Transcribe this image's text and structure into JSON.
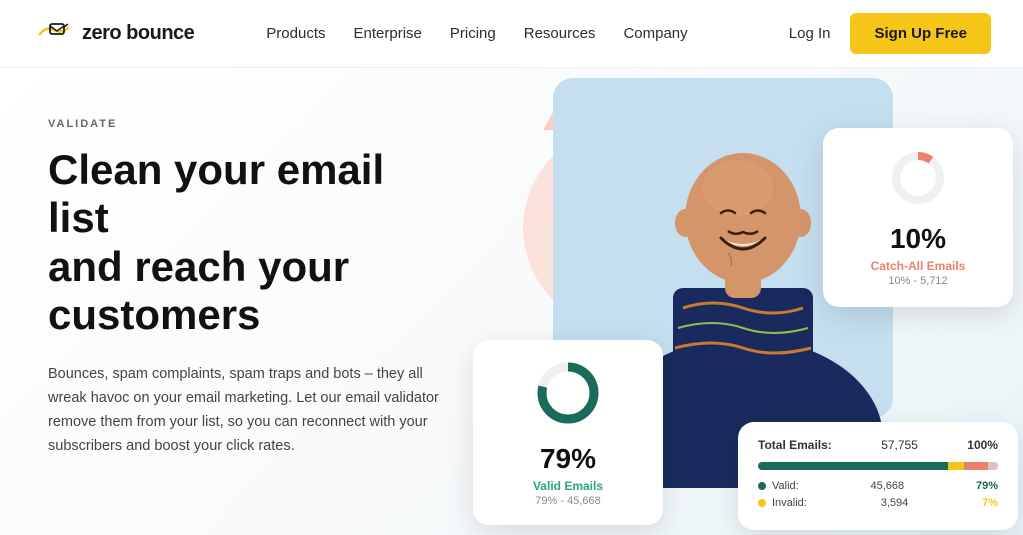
{
  "navbar": {
    "logo_text": "zero bounce",
    "nav_items": [
      {
        "label": "Products",
        "href": "#"
      },
      {
        "label": "Enterprise",
        "href": "#"
      },
      {
        "label": "Pricing",
        "href": "#"
      },
      {
        "label": "Resources",
        "href": "#"
      },
      {
        "label": "Company",
        "href": "#"
      }
    ],
    "login_label": "Log In",
    "signup_label": "Sign Up Free"
  },
  "hero": {
    "validate_label": "VALIDATE",
    "title_line1": "Clean your email list",
    "title_line2": "and reach your",
    "title_line3": "customers",
    "description": "Bounces, spam complaints, spam traps and bots – they all wreak havoc on your email marketing. Let our email validator remove them from your list, so you can reconnect with your subscribers and boost your click rates."
  },
  "catch_all_card": {
    "percent": "10%",
    "label": "Catch-All Emails",
    "sublabel": "10% - 5,712"
  },
  "valid_card": {
    "percent": "79%",
    "label": "Valid Emails",
    "sublabel": "79% - 45,668"
  },
  "total_card": {
    "label": "Total Emails:",
    "count": "57,755",
    "pct": "100%",
    "rows": [
      {
        "dot_color": "#1a6b5c",
        "name": "Valid:",
        "count": "45,668",
        "pct": "79%",
        "pct_color": "#1a6b5c"
      },
      {
        "dot_color": "#f5c518",
        "name": "Invalid:",
        "count": "3,594",
        "pct": "7%",
        "pct_color": "#f5c518"
      }
    ],
    "progress": [
      {
        "color": "#1a6b5c",
        "width": 79
      },
      {
        "color": "#f5c518",
        "width": 7
      },
      {
        "color": "#e8826b",
        "width": 10
      },
      {
        "color": "#e0c0c0",
        "width": 4
      }
    ]
  }
}
